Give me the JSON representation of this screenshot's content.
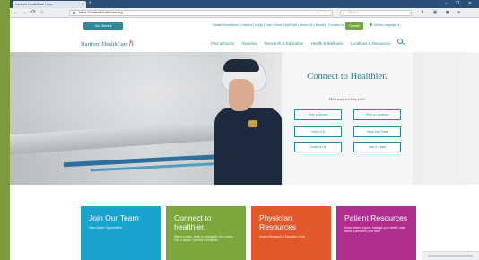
{
  "browser": {
    "tab_title": "Hartford HealthCare Hom...",
    "tab_close": "✕",
    "new_tab": "+",
    "window_controls": "– ❐ ✕",
    "nav_back": "←",
    "nav_forward": "→",
    "nav_reload": "⟳",
    "nav_home": "⌂",
    "url": "https://hartfordhealthcare.org",
    "url_icons": "••• ☆",
    "search_placeholder": "Search",
    "toolbar_icons": "⬇ ▣ ◼ ●"
  },
  "site": {
    "sites_dropdown": "Our Sites ▾",
    "utility_links": "HealthTrendsNow | Careers | Apply | Give Online | MyChart | About Us | Nurses | Contact Us",
    "donate": "Donate",
    "language": "Select Language ▾",
    "logo_text": "Hartford HealthCare",
    "logo_mark": "ℏ",
    "nav": [
      "Find a Doctor",
      "Services",
      "Research & Education",
      "Health & Wellness",
      "Locations & Resources"
    ]
  },
  "hero": {
    "title": "Connect to Healthier.",
    "subtitle": "How may we help you?",
    "buttons": [
      "Find a Doctor",
      "Find a Location",
      "Visit a ED",
      "View my Chart",
      "Contact Us",
      "Join a Class"
    ]
  },
  "tiles": [
    {
      "title": "Join Our Team",
      "desc": "View Career Opportunities",
      "color": "#1aa3cc"
    },
    {
      "title": "Connect to healthier.",
      "desc": "Watch a video, listen to a podcast, see a class. Find a doctor. Connect to healthier.",
      "color": "#7ba73c"
    },
    {
      "title": "Physician Resources",
      "desc": "Access Research & Education Tools",
      "color": "#e2582b"
    },
    {
      "title": "Patient Resources",
      "desc": "Know what to expect. Manage your health, learn about procedures, and more.",
      "color": "#b02e8e"
    }
  ]
}
